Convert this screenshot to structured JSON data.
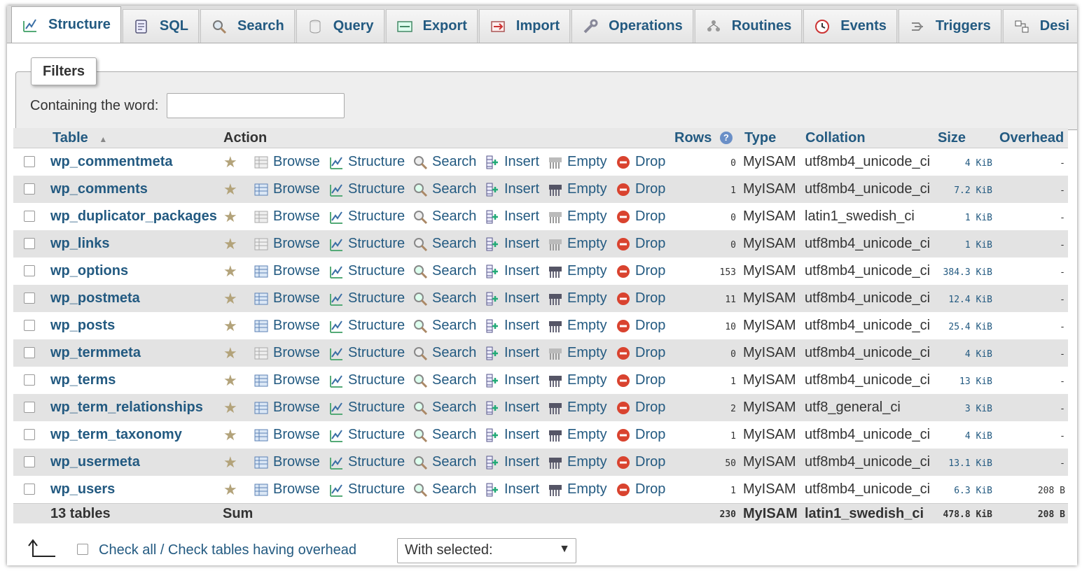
{
  "tabs": [
    {
      "label": "Structure",
      "icon": "structure-icon",
      "active": true
    },
    {
      "label": "SQL",
      "icon": "sql-icon"
    },
    {
      "label": "Search",
      "icon": "search-icon"
    },
    {
      "label": "Query",
      "icon": "query-icon"
    },
    {
      "label": "Export",
      "icon": "export-icon"
    },
    {
      "label": "Import",
      "icon": "import-icon"
    },
    {
      "label": "Operations",
      "icon": "wrench-icon"
    },
    {
      "label": "Routines",
      "icon": "routines-icon"
    },
    {
      "label": "Events",
      "icon": "clock-icon"
    },
    {
      "label": "Triggers",
      "icon": "triggers-icon"
    },
    {
      "label": "Desi",
      "icon": "designer-icon"
    }
  ],
  "filters": {
    "legend": "Filters",
    "label": "Containing the word:",
    "value": ""
  },
  "columns": {
    "table": "Table",
    "action": "Action",
    "rows": "Rows",
    "type": "Type",
    "collation": "Collation",
    "size": "Size",
    "overhead": "Overhead"
  },
  "actions": {
    "browse": "Browse",
    "structure": "Structure",
    "search": "Search",
    "insert": "Insert",
    "empty": "Empty",
    "drop": "Drop"
  },
  "tables": [
    {
      "name": "wp_commentmeta",
      "rows": "0",
      "type": "MyISAM",
      "collation": "utf8mb4_unicode_ci",
      "size": "4 KiB",
      "overhead": "-"
    },
    {
      "name": "wp_comments",
      "rows": "1",
      "type": "MyISAM",
      "collation": "utf8mb4_unicode_ci",
      "size": "7.2 KiB",
      "overhead": "-"
    },
    {
      "name": "wp_duplicator_packages",
      "rows": "0",
      "type": "MyISAM",
      "collation": "latin1_swedish_ci",
      "size": "1 KiB",
      "overhead": "-"
    },
    {
      "name": "wp_links",
      "rows": "0",
      "type": "MyISAM",
      "collation": "utf8mb4_unicode_ci",
      "size": "1 KiB",
      "overhead": "-"
    },
    {
      "name": "wp_options",
      "rows": "153",
      "type": "MyISAM",
      "collation": "utf8mb4_unicode_ci",
      "size": "384.3 KiB",
      "overhead": "-"
    },
    {
      "name": "wp_postmeta",
      "rows": "11",
      "type": "MyISAM",
      "collation": "utf8mb4_unicode_ci",
      "size": "12.4 KiB",
      "overhead": "-"
    },
    {
      "name": "wp_posts",
      "rows": "10",
      "type": "MyISAM",
      "collation": "utf8mb4_unicode_ci",
      "size": "25.4 KiB",
      "overhead": "-"
    },
    {
      "name": "wp_termmeta",
      "rows": "0",
      "type": "MyISAM",
      "collation": "utf8mb4_unicode_ci",
      "size": "4 KiB",
      "overhead": "-"
    },
    {
      "name": "wp_terms",
      "rows": "1",
      "type": "MyISAM",
      "collation": "utf8mb4_unicode_ci",
      "size": "13 KiB",
      "overhead": "-"
    },
    {
      "name": "wp_term_relationships",
      "rows": "2",
      "type": "MyISAM",
      "collation": "utf8_general_ci",
      "size": "3 KiB",
      "overhead": "-"
    },
    {
      "name": "wp_term_taxonomy",
      "rows": "1",
      "type": "MyISAM",
      "collation": "utf8mb4_unicode_ci",
      "size": "4 KiB",
      "overhead": "-"
    },
    {
      "name": "wp_usermeta",
      "rows": "50",
      "type": "MyISAM",
      "collation": "utf8mb4_unicode_ci",
      "size": "13.1 KiB",
      "overhead": "-"
    },
    {
      "name": "wp_users",
      "rows": "1",
      "type": "MyISAM",
      "collation": "utf8mb4_unicode_ci",
      "size": "6.3 KiB",
      "overhead": "208 B"
    }
  ],
  "summary": {
    "tables": "13 tables",
    "label": "Sum",
    "rows": "230",
    "type": "MyISAM",
    "collation": "latin1_swedish_ci",
    "size": "478.8 KiB",
    "overhead": "208 B"
  },
  "footer": {
    "check_all": "Check all / Check tables having overhead",
    "with_selected": "With selected:"
  },
  "colors": {
    "link": "#235a81",
    "drop_red": "#d9432f",
    "star": "#b3a37a"
  }
}
